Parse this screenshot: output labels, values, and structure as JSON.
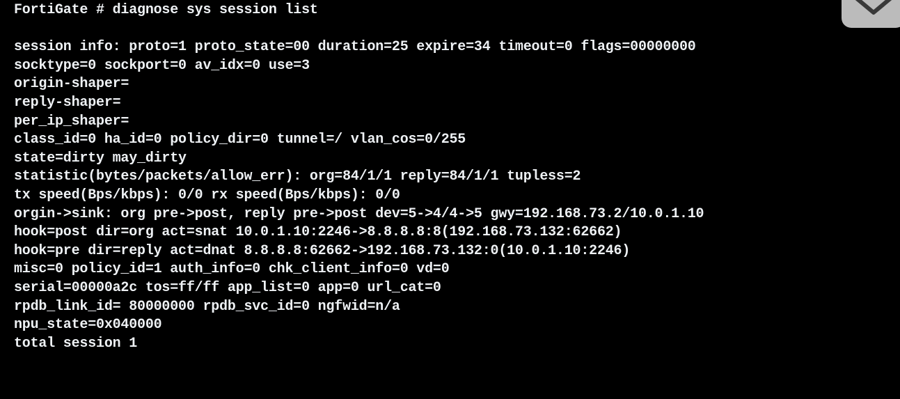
{
  "terminal": {
    "prompt": "FortiGate # ",
    "command": "diagnose sys session list",
    "lines": [
      "",
      "session info: proto=1 proto_state=00 duration=25 expire=34 timeout=0 flags=00000000",
      "socktype=0 sockport=0 av_idx=0 use=3",
      "origin-shaper=",
      "reply-shaper=",
      "per_ip_shaper=",
      "class_id=0 ha_id=0 policy_dir=0 tunnel=/ vlan_cos=0/255",
      "state=dirty may_dirty",
      "statistic(bytes/packets/allow_err): org=84/1/1 reply=84/1/1 tupless=2",
      "tx speed(Bps/kbps): 0/0 rx speed(Bps/kbps): 0/0",
      "orgin->sink: org pre->post, reply pre->post dev=5->4/4->5 gwy=192.168.73.2/10.0.1.10",
      "hook=post dir=org act=snat 10.0.1.10:2246->8.8.8.8:8(192.168.73.132:62662)",
      "hook=pre dir=reply act=dnat 8.8.8.8:62662->192.168.73.132:0(10.0.1.10:2246)",
      "misc=0 policy_id=1 auth_info=0 chk_client_info=0 vd=0",
      "serial=00000a2c tos=ff/ff app_list=0 app=0 url_cat=0",
      "rpdb_link_id= 80000000 rpdb_svc_id=0 ngfwid=n/a",
      "npu_state=0x040000",
      "total session 1"
    ]
  },
  "overlay": {
    "icon": "download-chevron-icon",
    "color": "#dcdcdc"
  }
}
